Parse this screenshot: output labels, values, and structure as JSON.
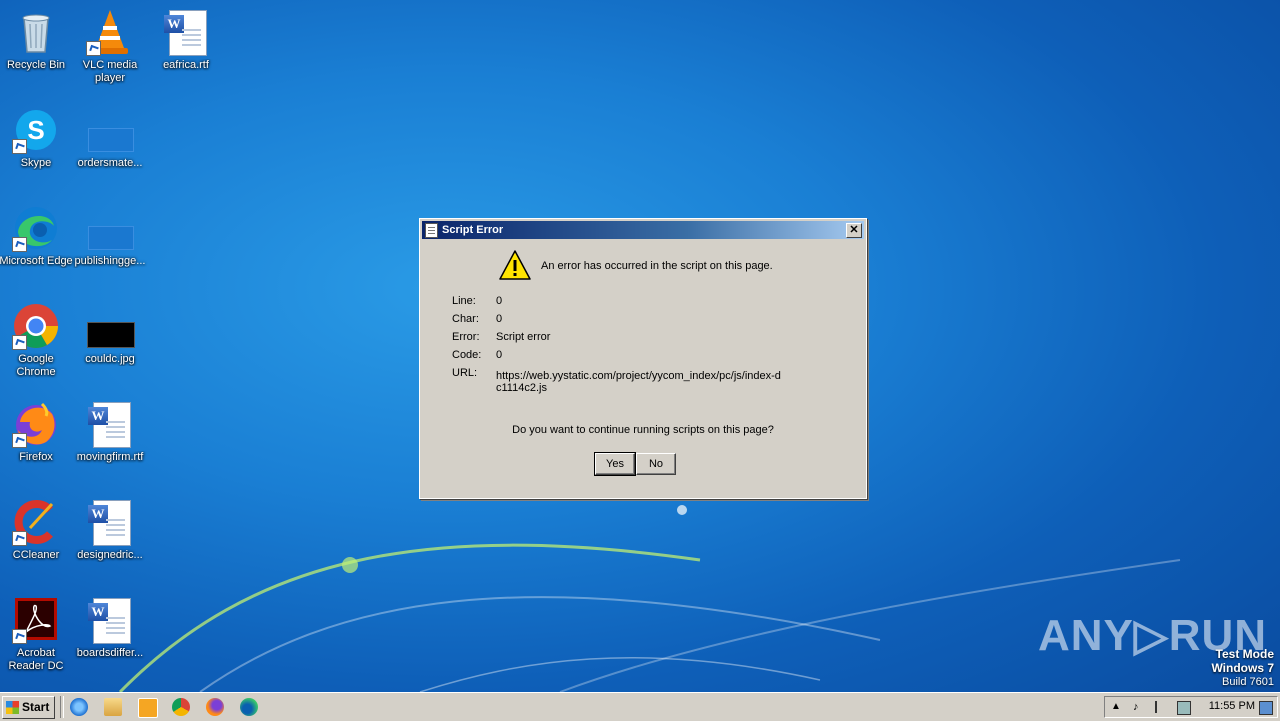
{
  "desktop": {
    "icons": [
      {
        "label": "Recycle Bin"
      },
      {
        "label": "VLC media player"
      },
      {
        "label": "eafrica.rtf"
      },
      {
        "label": "Skype"
      },
      {
        "label": "ordersmate..."
      },
      {
        "label": "Microsoft Edge"
      },
      {
        "label": "publishingge..."
      },
      {
        "label": "Google Chrome"
      },
      {
        "label": "couldc.jpg"
      },
      {
        "label": "Firefox"
      },
      {
        "label": "movingfirm.rtf"
      },
      {
        "label": "CCleaner"
      },
      {
        "label": "designedric..."
      },
      {
        "label": "Acrobat Reader DC"
      },
      {
        "label": "boardsdiffer..."
      }
    ]
  },
  "dialog": {
    "title": "Script Error",
    "message": "An error has occurred in the script on this page.",
    "fields": [
      {
        "key": "Line:",
        "value": "0"
      },
      {
        "key": "Char:",
        "value": "0"
      },
      {
        "key": "Error:",
        "value": "Script error"
      },
      {
        "key": "Code:",
        "value": "0"
      },
      {
        "key": "URL:",
        "value": "https://web.yystatic.com/project/yycom_index/pc/js/index-dc1114c2.js"
      }
    ],
    "question": "Do you want to continue running scripts on this page?",
    "yes_label": "Yes",
    "no_label": "No",
    "close_glyph": "✕"
  },
  "watermark": {
    "brand": "ANY▷RUN",
    "line1": "Test Mode",
    "line2": "Windows 7",
    "line3": "Build 7601"
  },
  "taskbar": {
    "start_label": "Start",
    "clock": "11:55 PM",
    "pinned": [
      "internet-explorer",
      "explorer",
      "media-player",
      "chrome",
      "firefox",
      "edge"
    ]
  },
  "colors": {
    "desktop": "#1a7fd4",
    "titlebar": "#0a246a",
    "dialog": "#d4d0c8"
  }
}
